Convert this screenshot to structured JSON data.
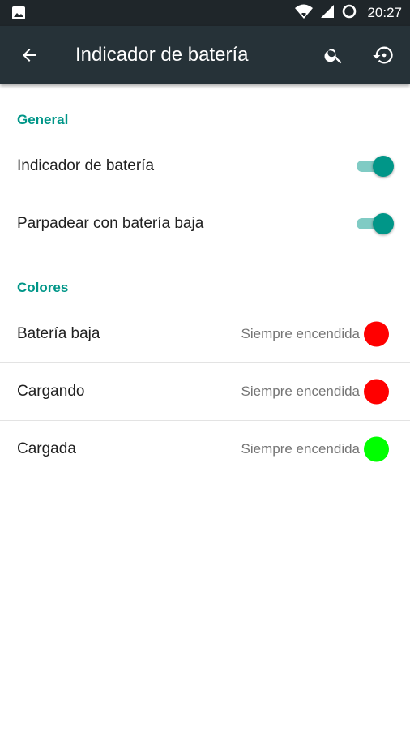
{
  "status_bar": {
    "time": "20:27",
    "icons": [
      "image-icon",
      "wifi-icon",
      "signal-icon",
      "sync-circle-icon"
    ]
  },
  "toolbar": {
    "title": "Indicador de batería",
    "back_icon": "arrow-back-icon",
    "search_icon": "search-icon",
    "reset_icon": "restore-icon"
  },
  "sections": {
    "general": {
      "header": "General",
      "items": [
        {
          "label": "Indicador de batería",
          "enabled": true
        },
        {
          "label": "Parpadear con batería baja",
          "enabled": true
        }
      ]
    },
    "colors": {
      "header": "Colores",
      "items": [
        {
          "label": "Batería baja",
          "summary": "Siempre encendida",
          "color": "#ff0000"
        },
        {
          "label": "Cargando",
          "summary": "Siempre encendida",
          "color": "#ff0000"
        },
        {
          "label": "Cargada",
          "summary": "Siempre encendida",
          "color": "#00ff00"
        }
      ]
    }
  },
  "colors": {
    "accent": "#009688",
    "accent_light": "#80cbc4",
    "toolbar_bg": "#263238",
    "statusbar_bg": "#1f262a"
  }
}
